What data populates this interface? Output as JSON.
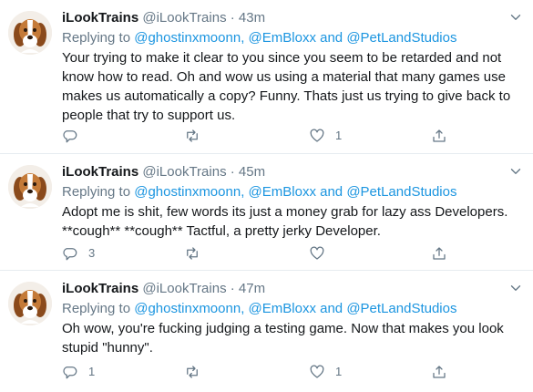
{
  "tweets": [
    {
      "name": "iLookTrains",
      "handle": "@iLookTrains",
      "dot": "·",
      "time": "43m",
      "replying_prefix": "Replying to ",
      "mention1": "@ghostinxmoonn",
      "sep1": ", ",
      "mention2": "@EmBloxx",
      "sep2": " and ",
      "mention3": "@PetLandStudios",
      "text": "Your trying to make it clear to you since you seem to be retarded and not know how to read. Oh and wow us using a material that many games use makes us automatically a copy? Funny. Thats just us trying to give back to people that try to support us.",
      "reply_count": "",
      "retweet_count": "",
      "like_count": "1"
    },
    {
      "name": "iLookTrains",
      "handle": "@iLookTrains",
      "dot": "·",
      "time": "45m",
      "replying_prefix": "Replying to ",
      "mention1": "@ghostinxmoonn",
      "sep1": ", ",
      "mention2": "@EmBloxx",
      "sep2": " and ",
      "mention3": "@PetLandStudios",
      "text": "Adopt me is shit, few words its just a money grab for lazy ass Developers.\n**cough** **cough** Tactful, a pretty jerky Developer.",
      "reply_count": "3",
      "retweet_count": "",
      "like_count": ""
    },
    {
      "name": "iLookTrains",
      "handle": "@iLookTrains",
      "dot": "·",
      "time": "47m",
      "replying_prefix": "Replying to ",
      "mention1": "@ghostinxmoonn",
      "sep1": ", ",
      "mention2": "@EmBloxx",
      "sep2": " and ",
      "mention3": "@PetLandStudios",
      "text": "Oh wow, you're fucking judging a testing game. Now that makes you look stupid \"hunny\".",
      "reply_count": "1",
      "retweet_count": "",
      "like_count": "1"
    }
  ],
  "icons": {
    "avatar": "dog-avatar-icon",
    "more": "chevron-down-icon",
    "reply": "reply-icon",
    "retweet": "retweet-icon",
    "like": "heart-icon",
    "share": "share-icon"
  },
  "colors": {
    "link": "#1b95e0",
    "secondary_text": "#657786",
    "primary_text": "#14171a",
    "divider": "#e6ecf0"
  }
}
